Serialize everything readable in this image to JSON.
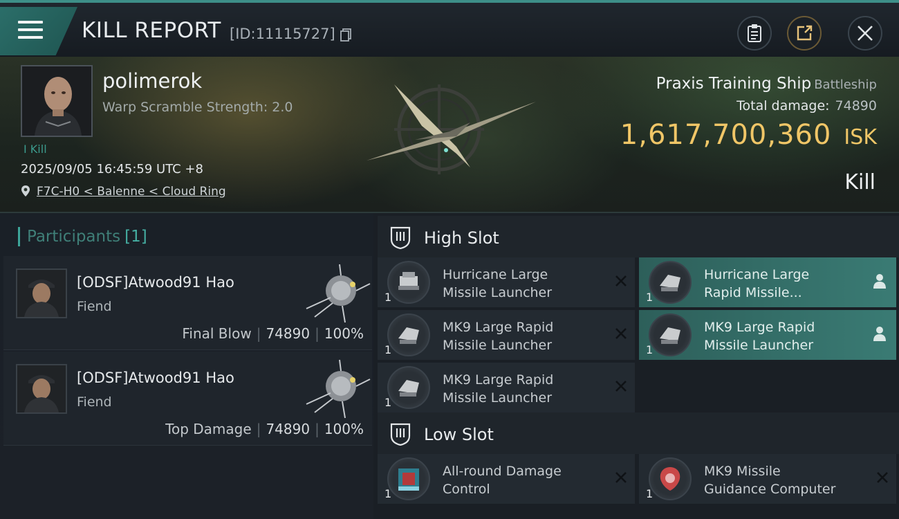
{
  "header": {
    "title": "KILL REPORT",
    "report_id": "[ID:11115727]",
    "icons": [
      "menu-icon",
      "copy-icon",
      "clipboard-icon",
      "share-icon",
      "close-icon"
    ]
  },
  "victim": {
    "name": "polimerok",
    "warp_scramble": "Warp Scramble Strength: 2.0",
    "tag": "I Kill",
    "datetime": "2025/09/05 16:45:59 UTC +8",
    "location": "F7C-H0 < Balenne < Cloud Ring",
    "ship_name": "Praxis Training Ship",
    "ship_class": "Battleship",
    "total_damage_label": "Total damage:",
    "total_damage_value": "74890",
    "isk_value": "1,617,700,360",
    "isk_unit": "ISK",
    "result": "Kill"
  },
  "participants": {
    "title": "Participants",
    "count": "[1]",
    "rows": [
      {
        "name": "[ODSF]Atwood91 Hao",
        "role": "Fiend",
        "label": "Final Blow",
        "damage": "74890",
        "percent": "100%"
      },
      {
        "name": "[ODSF]Atwood91 Hao",
        "role": "Fiend",
        "label": "Top Damage",
        "damage": "74890",
        "percent": "100%"
      }
    ]
  },
  "slots": {
    "high": {
      "title": "High Slot",
      "modules": [
        {
          "line1": "Hurricane Large",
          "line2": "Missile Launcher",
          "qty": "1",
          "active": false
        },
        {
          "line1": "Hurricane Large",
          "line2": "Rapid Missile...",
          "qty": "1",
          "active": true
        },
        {
          "line1": "MK9 Large Rapid",
          "line2": "Missile Launcher",
          "qty": "1",
          "active": false
        },
        {
          "line1": "MK9 Large Rapid",
          "line2": "Missile Launcher",
          "qty": "1",
          "active": true
        },
        {
          "line1": "MK9 Large Rapid",
          "line2": "Missile Launcher",
          "qty": "1",
          "active": false
        }
      ]
    },
    "low": {
      "title": "Low Slot",
      "modules": [
        {
          "line1": "All-round Damage",
          "line2": "Control",
          "qty": "1",
          "active": false
        },
        {
          "line1": "MK9 Missile",
          "line2": "Guidance Computer",
          "qty": "1",
          "active": false
        }
      ]
    }
  },
  "colors": {
    "accent_teal": "#3d8f88",
    "isk_gold": "#f0c667",
    "active_module": "#3a7b74"
  }
}
